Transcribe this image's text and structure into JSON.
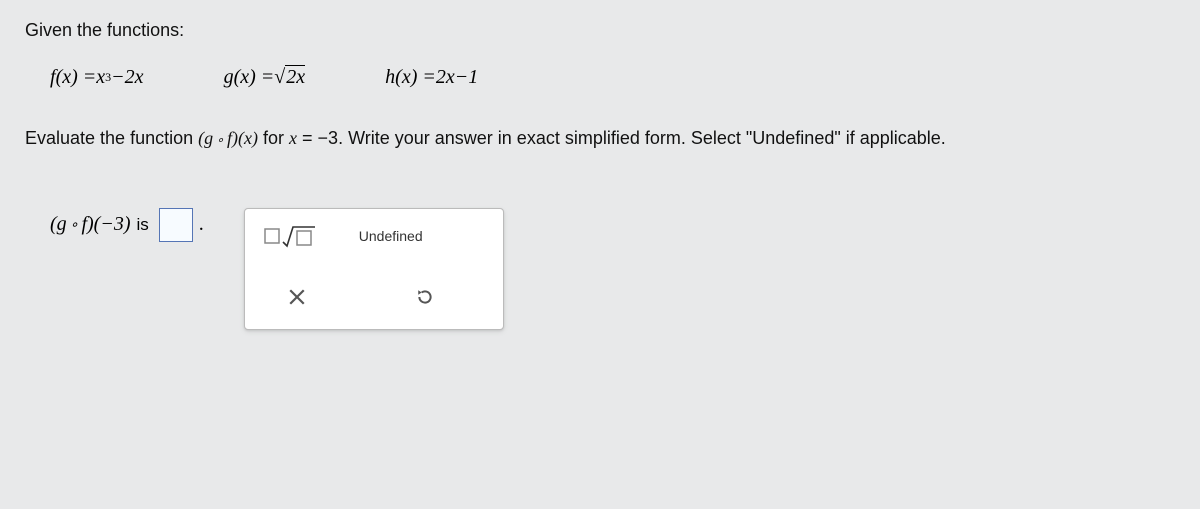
{
  "intro": "Given the functions:",
  "functions": {
    "f_label": "f",
    "g_label": "g",
    "h_label": "h",
    "var": "x",
    "f_term2_coef": "2",
    "g_inner_coef": "2",
    "h_coef": "2",
    "h_const": "1",
    "f_exp": "3"
  },
  "instruction": {
    "pre": "Evaluate the function ",
    "comp_open": "(",
    "comp_g": "g",
    "comp_f": "f",
    "comp_close": ")",
    "comp_arg": "(x)",
    "for_text": " for ",
    "x_eq": "x",
    "eq": " = ",
    "val": "−3",
    "rest": ". Write your answer in exact simplified form. Select \"Undefined\" if applicable."
  },
  "answer": {
    "expr_open": "(",
    "g": "g",
    "f": "f",
    "expr_close": ")",
    "arg": "(−3)",
    "is": "is",
    "period": "."
  },
  "toolbox": {
    "undefined_label": "Undefined"
  }
}
